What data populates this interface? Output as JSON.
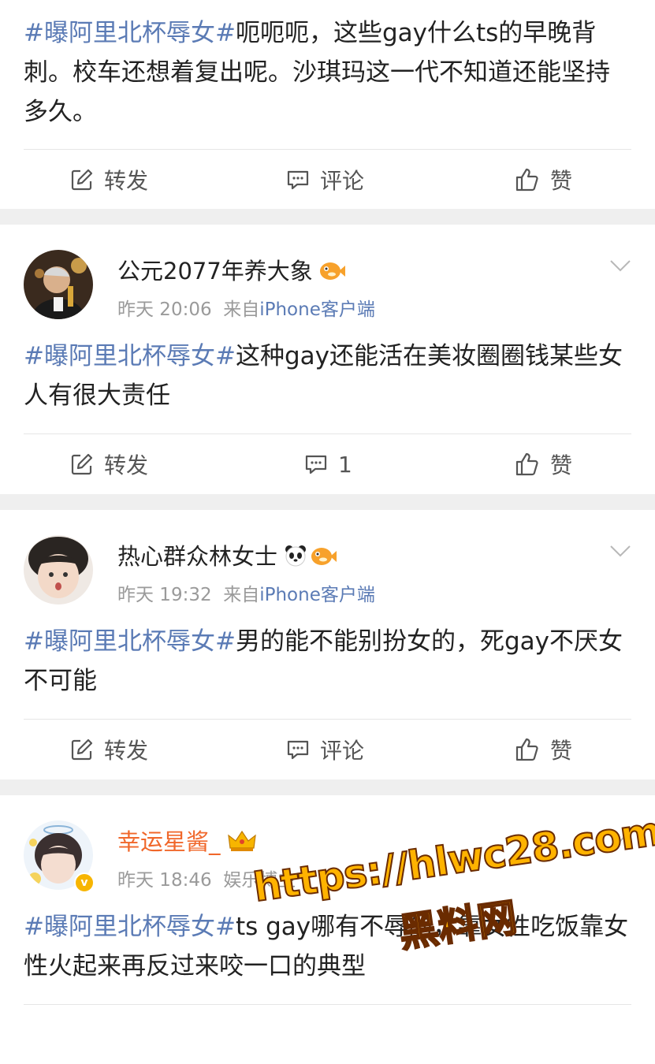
{
  "actions_labels": {
    "repost": "转发",
    "comment": "评论",
    "like": "赞"
  },
  "post0": {
    "hashtag": "#曝阿里北杯辱女#",
    "text": "呃呃呃，这些gay什么ts的早晚背刺。校车还想着复出呢。沙琪玛这一代不知道还能坚持多久。"
  },
  "post1": {
    "username": "公元2077年养大象",
    "time": "昨天 20:06",
    "from_prefix": "来自",
    "source": "iPhone客户端",
    "hashtag": "#曝阿里北杯辱女#",
    "text": "这种gay还能活在美妆圈圈钱某些女人有很大责任",
    "comment_count": "1"
  },
  "post2": {
    "username": "热心群众林女士",
    "time": "昨天 19:32",
    "from_prefix": "来自",
    "source": "iPhone客户端",
    "hashtag": "#曝阿里北杯辱女#",
    "text": "男的能不能别扮女的，死gay不厌女不可能"
  },
  "post3": {
    "username": "幸运星酱_",
    "time": "昨天 18:46",
    "role": "娱乐博主",
    "hashtag": "#曝阿里北杯辱女#",
    "text": "ts gay哪有不辱的，靠女性吃饭靠女性火起来再反过来咬一口的典型"
  },
  "watermark": {
    "url": "https://hlwc28.com",
    "name": "黑料网"
  },
  "colors": {
    "hashtag": "#5b7bb5",
    "vip_name": "#f0672a",
    "separator": "#efefef",
    "watermark": "#ffb300"
  },
  "icons": {
    "repost": "edit-square-icon",
    "comment": "comment-bubble-icon",
    "like": "thumbs-up-icon",
    "more": "chevron-down-icon"
  }
}
